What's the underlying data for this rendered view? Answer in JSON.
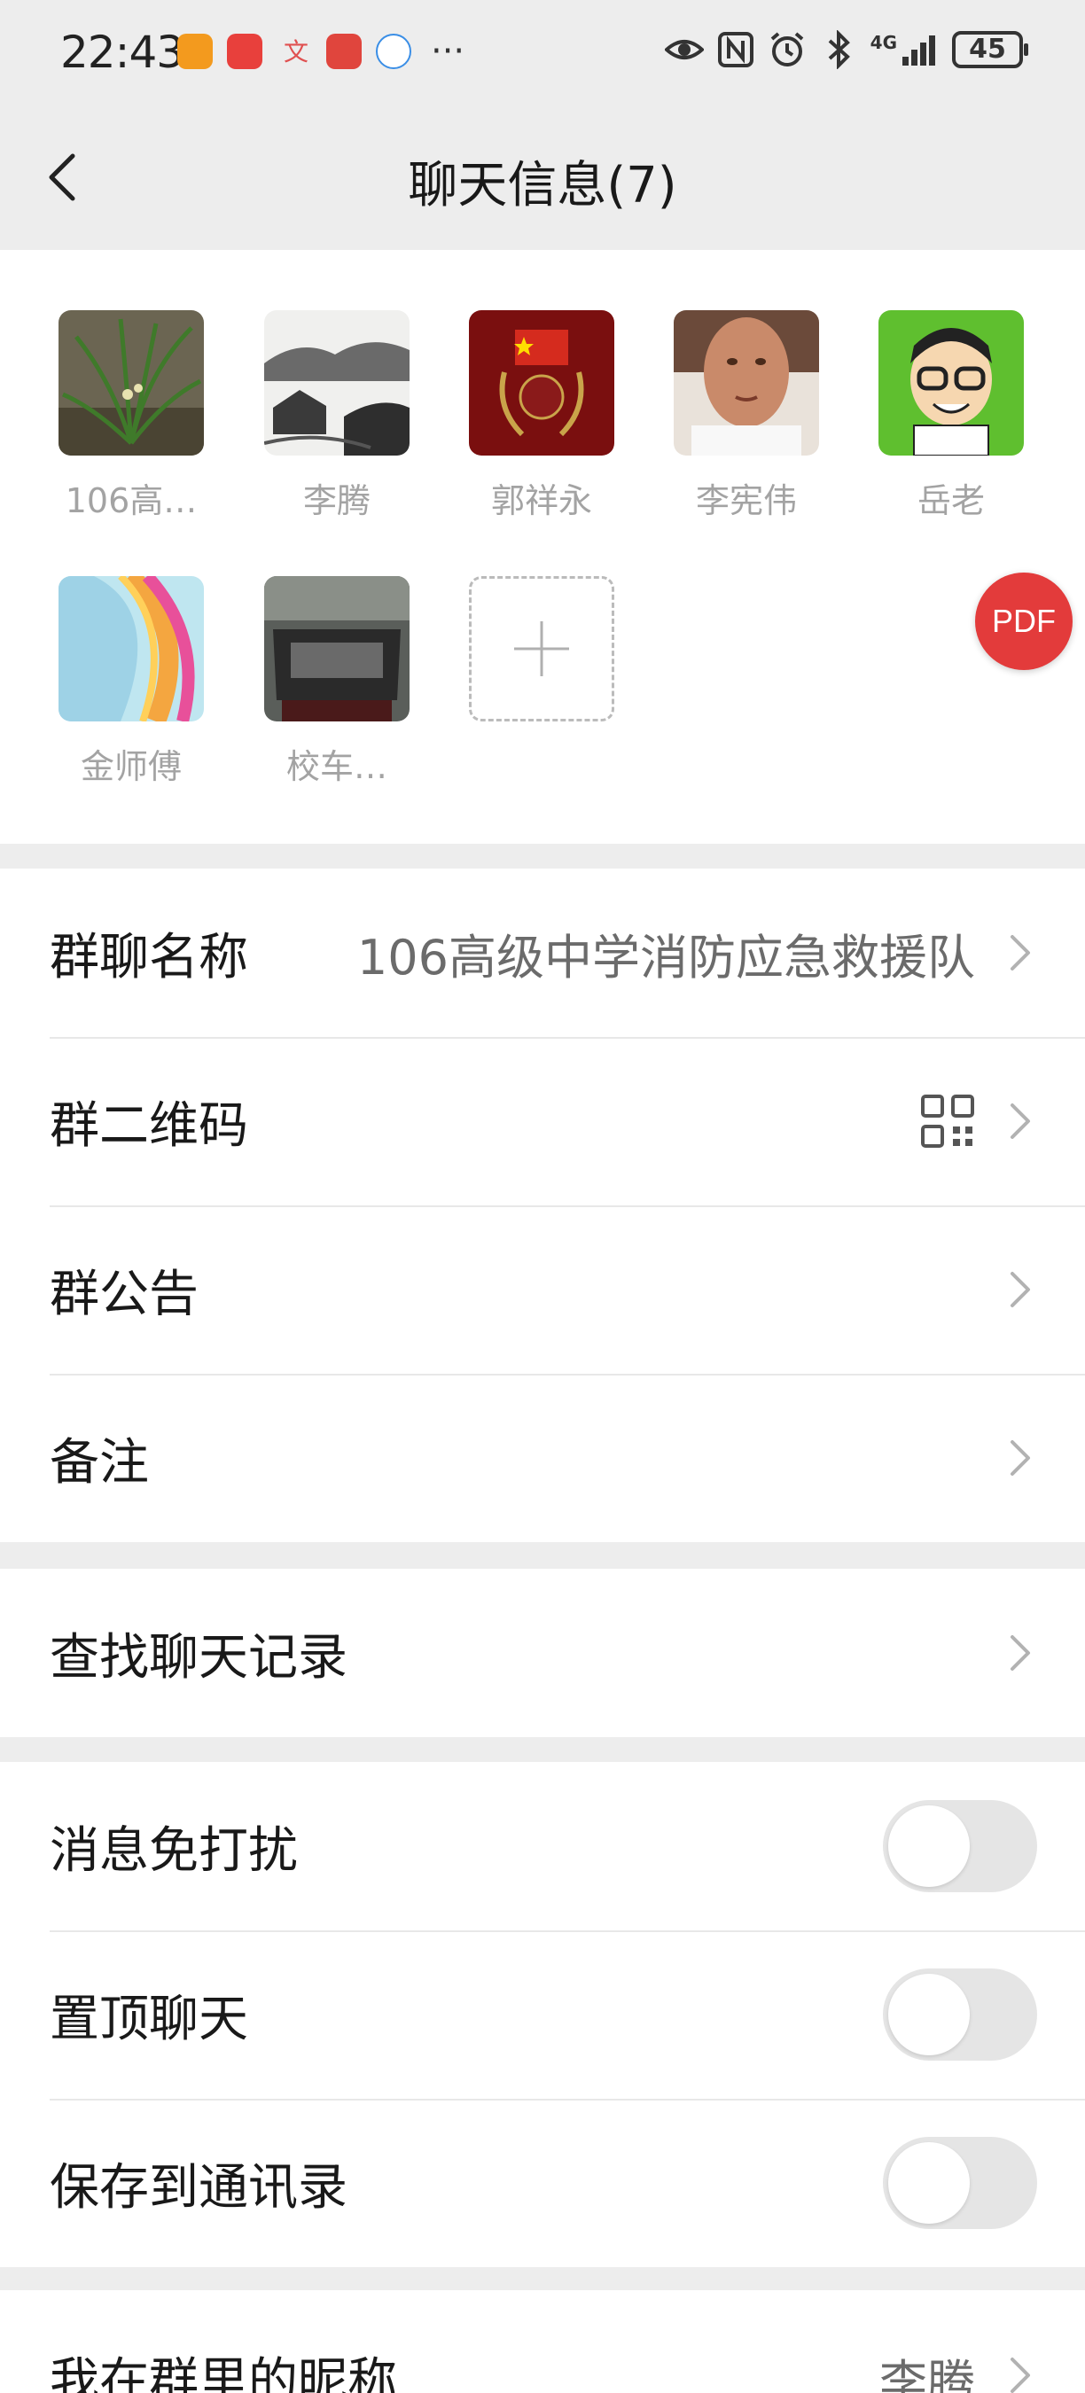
{
  "status_bar": {
    "time": "22:43",
    "network": "4G",
    "battery": "45",
    "more_indicator": "···",
    "notification_icons": [
      "app-orange-icon",
      "huawei-icon",
      "translate-icon",
      "redbox-icon",
      "browser-icon"
    ],
    "system_icons": [
      "eye-icon",
      "nfc-icon",
      "alarm-icon",
      "bluetooth-icon",
      "signal-icon",
      "battery-icon"
    ]
  },
  "header": {
    "title": "聊天信息(7)",
    "back_icon": "chevron-left-icon"
  },
  "members": [
    {
      "name": "106高…",
      "avatar": "orchid-plant"
    },
    {
      "name": "李腾",
      "avatar": "ink-landscape"
    },
    {
      "name": "郭祥永",
      "avatar": "red-emblem"
    },
    {
      "name": "李宪伟",
      "avatar": "face-photo"
    },
    {
      "name": "岳老",
      "avatar": "cartoon-glasses"
    },
    {
      "name": "金师傅",
      "avatar": "abstract-swirl"
    },
    {
      "name": "校车…",
      "avatar": "car-engine"
    }
  ],
  "add_member_icon": "plus-icon",
  "pdf_fab": {
    "label": "PDF"
  },
  "settings": {
    "group_name": {
      "label": "群聊名称",
      "value": "106高级中学消防应急救援队"
    },
    "qr_code": {
      "label": "群二维码",
      "icon": "qr-code-icon"
    },
    "announcement": {
      "label": "群公告"
    },
    "remark": {
      "label": "备注"
    },
    "search_history": {
      "label": "查找聊天记录"
    },
    "mute": {
      "label": "消息免打扰",
      "on": false
    },
    "pin": {
      "label": "置顶聊天",
      "on": false
    },
    "save_contacts": {
      "label": "保存到通讯录",
      "on": false
    },
    "my_nickname": {
      "label": "我在群里的昵称",
      "value": "李腾"
    }
  },
  "colors": {
    "background": "#ededed",
    "panel": "#ffffff",
    "muted_text": "#a3a3a3",
    "toggle_off": "#e5e5e5",
    "pdf_red": "#e33b3b"
  }
}
